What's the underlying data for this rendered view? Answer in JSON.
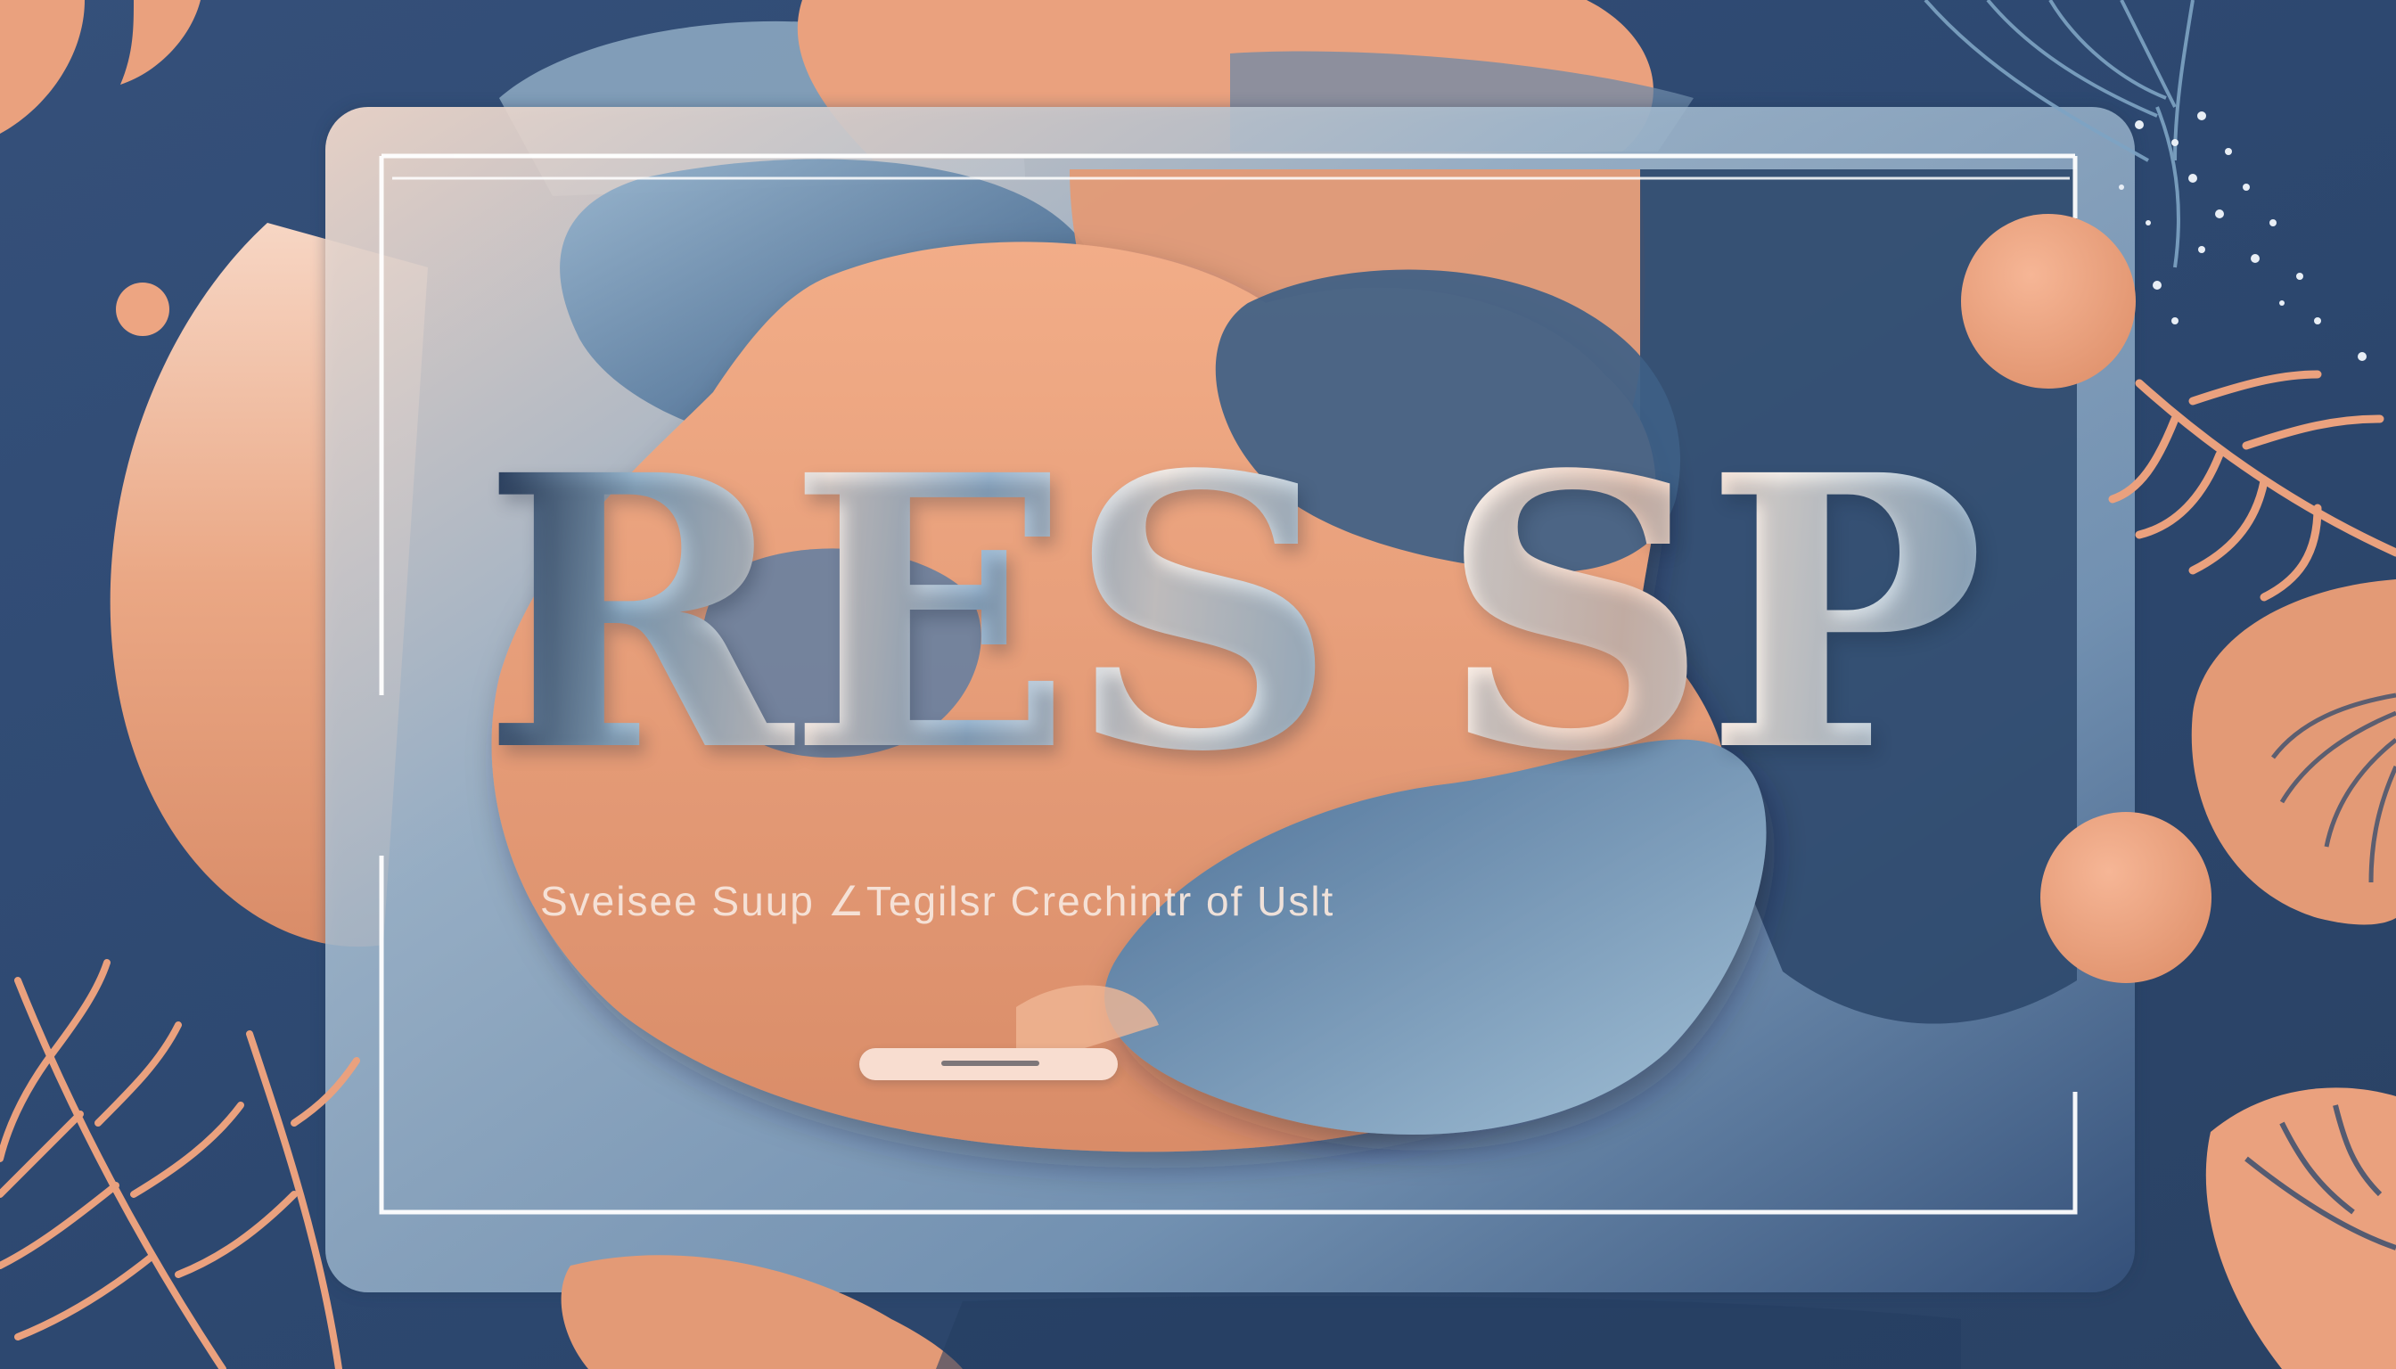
{
  "poster": {
    "headline_word_1": "RES",
    "headline_word_2": "SP",
    "tagline": "Sveisee Suup ∠Tegilsr Crechintr of Uslt",
    "cta_label": ""
  },
  "colors": {
    "navy_background": "#2f4a6e",
    "peach_accent": "#e9a07c",
    "steel_blue": "#7ea4c4",
    "cream": "#f7e6dc",
    "frame_line": "#ffffff"
  },
  "decorations": {
    "top_left_corner": "peach-leaf-icon",
    "bottom_left_corner": "peach-fern-icon",
    "top_right_corner": "blue-sprig-icon",
    "right_side": "peach-fern-icon",
    "bottom_right_corner": "peach-leaf-icon",
    "dots": "peach-circle-icon"
  }
}
